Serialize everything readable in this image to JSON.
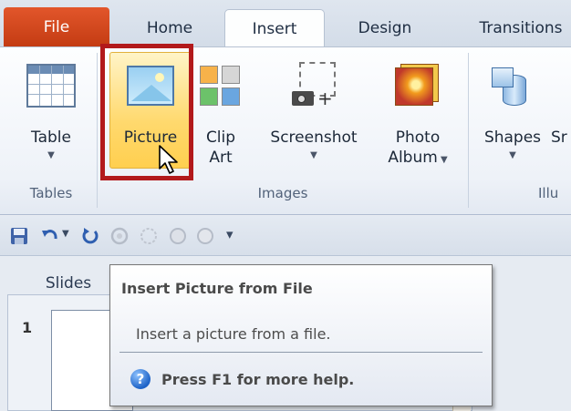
{
  "tabs": {
    "file": "File",
    "home": "Home",
    "insert": "Insert",
    "design": "Design",
    "transitions": "Transitions"
  },
  "ribbon": {
    "table": {
      "label": "Table"
    },
    "picture": {
      "label": "Picture"
    },
    "clipart": {
      "line1": "Clip",
      "line2": "Art"
    },
    "screenshot": {
      "label": "Screenshot"
    },
    "photo_album": {
      "line1": "Photo",
      "line2": "Album"
    },
    "shapes": {
      "label": "Shapes"
    },
    "next_partial": "Sr",
    "groups": {
      "tables": "Tables",
      "images": "Images",
      "illustrations_partial": "Illu"
    }
  },
  "slides_pane": {
    "tab": "Slides",
    "slide_number": "1"
  },
  "tooltip": {
    "title": "Insert Picture from File",
    "description": "Insert a picture from a file.",
    "help_text": "Press F1 for more help."
  },
  "colors": {
    "file_tab": "#c9431a",
    "highlight_frame": "#b2191b",
    "hover_fill": "#ffd96e"
  }
}
